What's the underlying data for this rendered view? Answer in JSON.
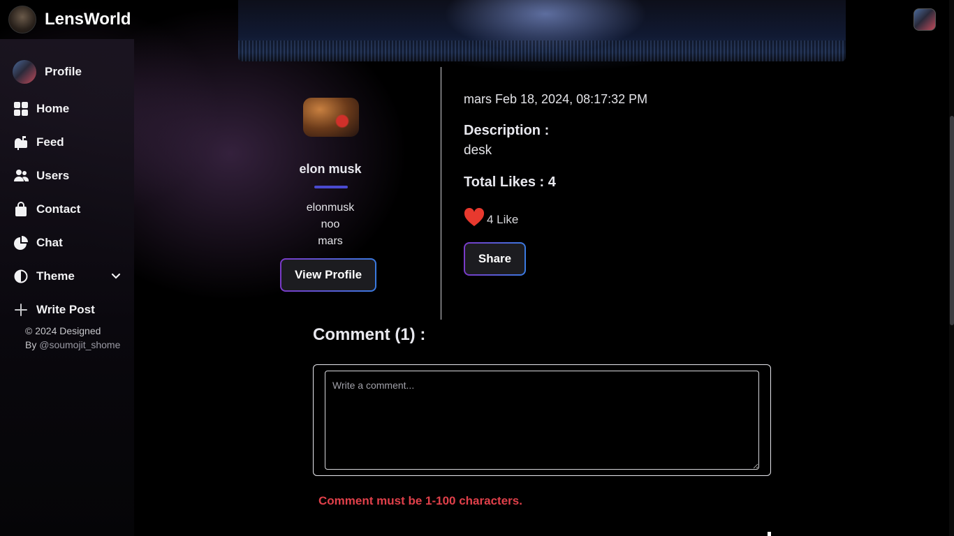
{
  "app": {
    "brand": "LensWorld",
    "accent_gradient": [
      "#7a3ac8",
      "#3a7ae0"
    ]
  },
  "sidebar": {
    "profile_label": "Profile",
    "items": [
      {
        "label": "Home",
        "icon": "grid-icon"
      },
      {
        "label": "Feed",
        "icon": "mailbox-icon"
      },
      {
        "label": "Users",
        "icon": "users-icon"
      },
      {
        "label": "Contact",
        "icon": "shopping-bag-icon"
      },
      {
        "label": "Chat",
        "icon": "pie-chart-icon"
      },
      {
        "label": "Theme",
        "icon": "half-circle-icon"
      },
      {
        "label": "Write Post",
        "icon": "plus-icon"
      }
    ],
    "footer_line1": "© 2024 Designed",
    "footer_by": "By",
    "footer_handle": "@soumojit_shome"
  },
  "author": {
    "name": "elon musk",
    "lines": [
      "elonmusk",
      "noo",
      "mars"
    ],
    "view_profile_label": "View Profile"
  },
  "post": {
    "location_date": "mars Feb 18, 2024, 08:17:32 PM",
    "description_heading": "Description :",
    "description": "desk",
    "total_likes_text": "Total Likes : 4",
    "like_text": "4 Like",
    "share_label": "Share",
    "like_color": "#e8392e"
  },
  "comments": {
    "heading": "Comment (1) :",
    "placeholder": "Write a comment...",
    "error": "Comment must be 1-100 characters.",
    "error_color": "#e0404a"
  }
}
